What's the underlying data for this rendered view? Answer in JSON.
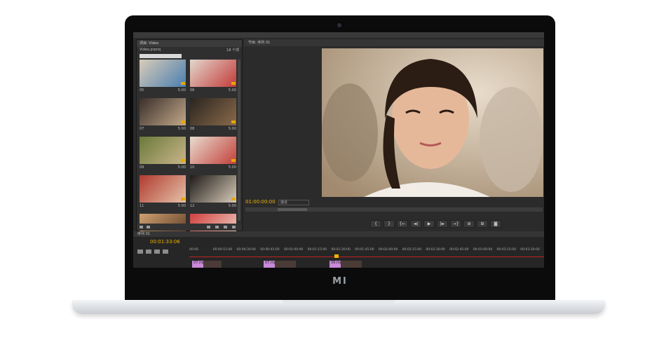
{
  "device": {
    "brand": "MI"
  },
  "project_panel": {
    "tab": "项目: Video",
    "file_name": "Video.prproj",
    "item_count": "18 个项",
    "clips": [
      {
        "label": "05",
        "duration": "5:00",
        "colors": [
          "#d9ccb8",
          "#4a7fb0"
        ]
      },
      {
        "label": "06",
        "duration": "5:00",
        "colors": [
          "#e2d8cc",
          "#c43a3a"
        ]
      },
      {
        "label": "07",
        "duration": "5:00",
        "colors": [
          "#3a2f2a",
          "#c2a88a"
        ]
      },
      {
        "label": "08",
        "duration": "5:00",
        "colors": [
          "#2a2520",
          "#8a6a4a"
        ]
      },
      {
        "label": "09",
        "duration": "5:00",
        "colors": [
          "#6a7a3a",
          "#c9b48a"
        ]
      },
      {
        "label": "10",
        "duration": "5:00",
        "colors": [
          "#e8dcd0",
          "#c2403a"
        ]
      },
      {
        "label": "11",
        "duration": "5:00",
        "colors": [
          "#b03a30",
          "#e6c2a8"
        ]
      },
      {
        "label": "12",
        "duration": "5:00",
        "colors": [
          "#1e1a18",
          "#d8cbb8"
        ]
      },
      {
        "label": "13",
        "duration": "5:00",
        "colors": [
          "#cfa070",
          "#5a3a26"
        ]
      },
      {
        "label": "14",
        "duration": "5:00",
        "colors": [
          "#d04040",
          "#f0d8c8"
        ]
      }
    ]
  },
  "program_monitor": {
    "tab": "节目: 序列 01",
    "timecode": "01:00:00:00",
    "fit": "适合",
    "controls": [
      "{",
      "}",
      "{←",
      "◄|",
      "▶",
      "|►",
      "→}",
      "⊕",
      "⊞",
      "◙"
    ]
  },
  "timeline": {
    "tab": "序列 01",
    "timecode": "00:01:33:06",
    "ruler_labels": [
      "00:00",
      "00:00:15:00",
      "00:00:30:00",
      "00:00:45:00",
      "00:01:00:00",
      "00:01:15:00",
      "00:01:30:00",
      "00:01:45:00",
      "00:02:00:00",
      "00:02:15:00",
      "00:02:30:00",
      "00:02:45:00",
      "00:03:00:00",
      "00:03:15:00",
      "00:03:30:00"
    ],
    "clip_labels": [
      "07.mp4",
      "07.mp4",
      "09.mp4"
    ]
  },
  "colors": {
    "timecode": "#f2b400",
    "clip": "#c98ad8",
    "panel_bg": "#2b2b2b"
  }
}
